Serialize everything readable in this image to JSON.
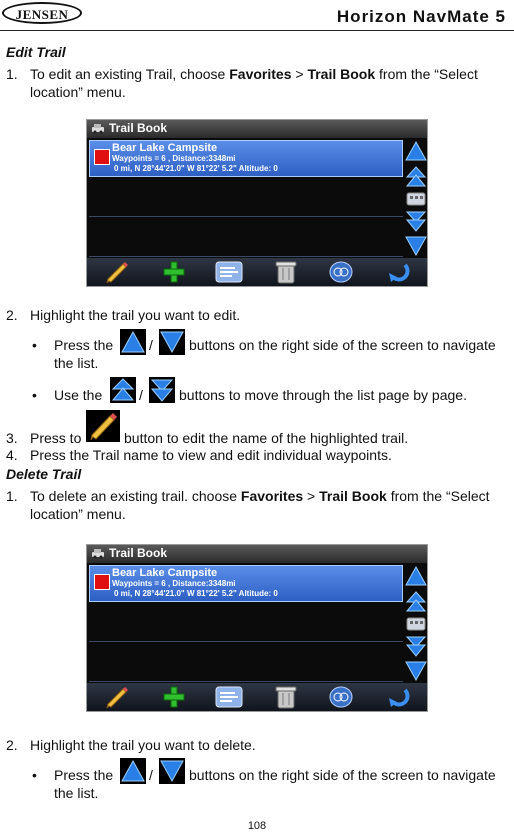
{
  "header": {
    "logo": "JENSEN",
    "title": "Horizon NavMate 5"
  },
  "edit": {
    "heading": "Edit Trail",
    "step1": {
      "num": "1.",
      "pre": "To edit an existing Trail, choose ",
      "fav": "Favorites",
      "gt": " > ",
      "book": "Trail Book",
      "post1": " from the “Select",
      "post2": "location” menu."
    },
    "step2": {
      "num": "2.",
      "text": "Highlight the trail you want to edit."
    },
    "bullet1": {
      "dot": "•",
      "pre": "Press the",
      "slash": "/",
      "post1": "buttons on the right side of the screen to navigate",
      "post2": "the list."
    },
    "bullet2": {
      "dot": "•",
      "pre": "Use the",
      "slash": "/",
      "post": "buttons to move through the list page by page."
    },
    "step3": {
      "num": "3.",
      "pre": "Press to",
      "post": "button to edit the name of the highlighted trail."
    },
    "step4": {
      "num": "4.",
      "text": "Press the Trail name to view and edit individual waypoints."
    }
  },
  "delete": {
    "heading": "Delete Trail",
    "step1": {
      "num": "1.",
      "pre": "To delete an existing trail. choose ",
      "fav": "Favorites",
      "gt": " > ",
      "book": "Trail Book",
      "post1": " from the “Select",
      "post2": "location” menu."
    },
    "step2": {
      "num": "2.",
      "text": "Highlight the trail you want to delete."
    },
    "bullet1": {
      "dot": "•",
      "pre": "Press the",
      "slash": "/",
      "post1": "buttons on the right side of the screen to navigate",
      "post2": "the list."
    }
  },
  "screen": {
    "title": "Trail Book",
    "item_name": "Bear Lake Campsite",
    "item_line2": "Waypoints = 6   , Distance:3348mi",
    "item_line3": "0 mi, N 28°44'21.0\"  W 81°22' 5.2\"  Altitude: 0",
    "colors": {
      "highlight": "#3f76d8",
      "marker": "#e01010",
      "arrow": "#2a7fe6",
      "plus": "#2fbf2f"
    }
  },
  "footer": {
    "page": "108"
  }
}
